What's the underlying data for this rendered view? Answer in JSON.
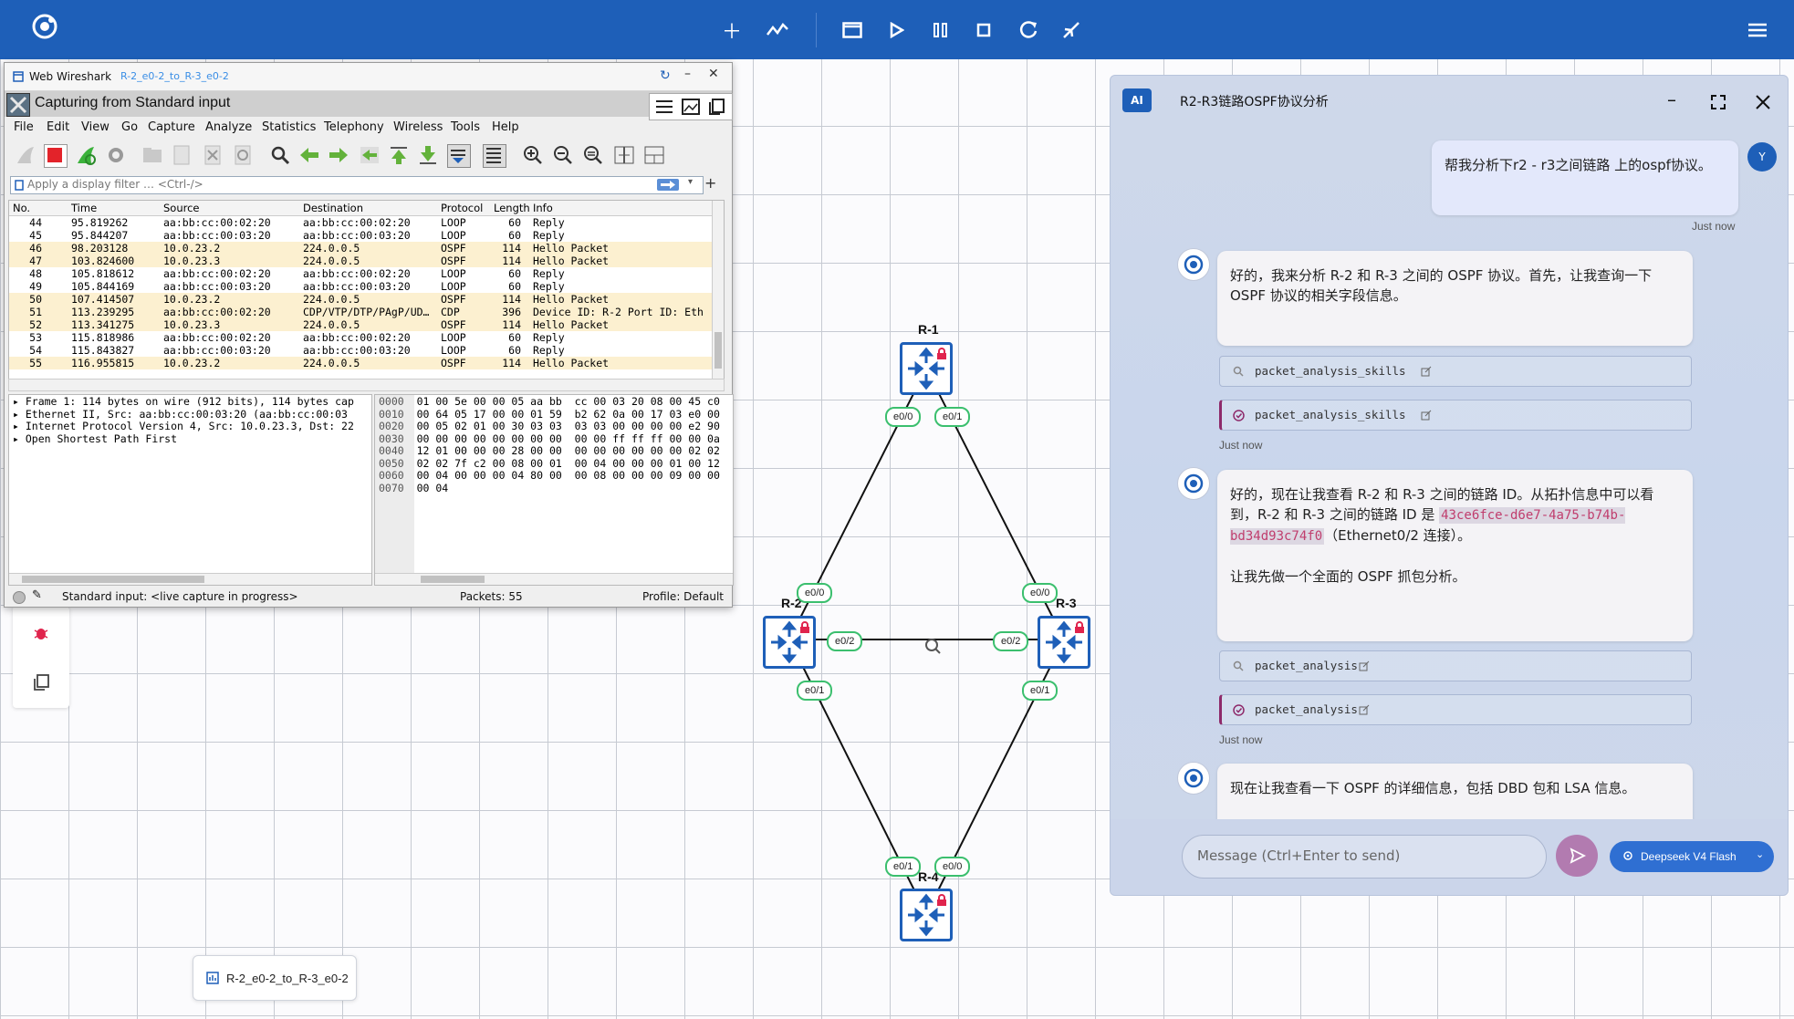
{
  "toolbar": {
    "icons": [
      "plus-icon",
      "chart-line-icon",
      "window-icon",
      "play-icon",
      "pause-icon",
      "stop-icon",
      "reload-icon",
      "collapse-icon",
      "menu-icon"
    ]
  },
  "link_tab": {
    "label": "R-2_e0-2_to_R-3_e0-2"
  },
  "topology": {
    "routers": [
      "R-1",
      "R-2",
      "R-3",
      "R-4"
    ],
    "ports": {
      "r1_e00": "e0/0",
      "r1_e01": "e0/1",
      "r2_e00": "e0/0",
      "r2_e02": "e0/2",
      "r2_e01": "e0/1",
      "r3_e00": "e0/0",
      "r3_e02": "e0/2",
      "r3_e01": "e0/1",
      "r4_e01": "e0/1",
      "r4_e00": "e0/0"
    },
    "colors": {
      "router": "#1e5fb8",
      "port": "#3bbf6e",
      "lock": "#e0244d"
    }
  },
  "wireshark": {
    "app_title": "Web Wireshark",
    "tab_title": "R-2_e0-2_to_R-3_e0-2",
    "capture_title": "Capturing from Standard input",
    "menu": [
      "File",
      "Edit",
      "View",
      "Go",
      "Capture",
      "Analyze",
      "Statistics",
      "Telephony",
      "Wireless",
      "Tools",
      "Help"
    ],
    "filter_placeholder": "Apply a display filter … <Ctrl-/>",
    "columns": [
      "No.",
      "Time",
      "Source",
      "Destination",
      "Protocol",
      "Length",
      "Info"
    ],
    "packets": [
      {
        "no": "44",
        "time": "95.819262",
        "src": "aa:bb:cc:00:02:20",
        "dst": "aa:bb:cc:00:02:20",
        "proto": "LOOP",
        "len": "60",
        "info": "Reply",
        "hl": false
      },
      {
        "no": "45",
        "time": "95.844207",
        "src": "aa:bb:cc:00:03:20",
        "dst": "aa:bb:cc:00:03:20",
        "proto": "LOOP",
        "len": "60",
        "info": "Reply",
        "hl": false
      },
      {
        "no": "46",
        "time": "98.203128",
        "src": "10.0.23.2",
        "dst": "224.0.0.5",
        "proto": "OSPF",
        "len": "114",
        "info": "Hello Packet",
        "hl": true
      },
      {
        "no": "47",
        "time": "103.824600",
        "src": "10.0.23.3",
        "dst": "224.0.0.5",
        "proto": "OSPF",
        "len": "114",
        "info": "Hello Packet",
        "hl": true
      },
      {
        "no": "48",
        "time": "105.818612",
        "src": "aa:bb:cc:00:02:20",
        "dst": "aa:bb:cc:00:02:20",
        "proto": "LOOP",
        "len": "60",
        "info": "Reply",
        "hl": false
      },
      {
        "no": "49",
        "time": "105.844169",
        "src": "aa:bb:cc:00:03:20",
        "dst": "aa:bb:cc:00:03:20",
        "proto": "LOOP",
        "len": "60",
        "info": "Reply",
        "hl": false
      },
      {
        "no": "50",
        "time": "107.414507",
        "src": "10.0.23.2",
        "dst": "224.0.0.5",
        "proto": "OSPF",
        "len": "114",
        "info": "Hello Packet",
        "hl": true
      },
      {
        "no": "51",
        "time": "113.239295",
        "src": "aa:bb:cc:00:02:20",
        "dst": "CDP/VTP/DTP/PAgP/UD…",
        "proto": "CDP",
        "len": "396",
        "info": "Device ID: R-2  Port ID: Eth",
        "hl": true
      },
      {
        "no": "52",
        "time": "113.341275",
        "src": "10.0.23.3",
        "dst": "224.0.0.5",
        "proto": "OSPF",
        "len": "114",
        "info": "Hello Packet",
        "hl": true
      },
      {
        "no": "53",
        "time": "115.818986",
        "src": "aa:bb:cc:00:02:20",
        "dst": "aa:bb:cc:00:02:20",
        "proto": "LOOP",
        "len": "60",
        "info": "Reply",
        "hl": false
      },
      {
        "no": "54",
        "time": "115.843827",
        "src": "aa:bb:cc:00:03:20",
        "dst": "aa:bb:cc:00:03:20",
        "proto": "LOOP",
        "len": "60",
        "info": "Reply",
        "hl": false
      },
      {
        "no": "55",
        "time": "116.955815",
        "src": "10.0.23.2",
        "dst": "224.0.0.5",
        "proto": "OSPF",
        "len": "114",
        "info": "Hello Packet",
        "hl": true
      }
    ],
    "details": [
      "Frame 1: 114 bytes on wire (912 bits), 114 bytes cap",
      "Ethernet II, Src: aa:bb:cc:00:03:20 (aa:bb:cc:00:03",
      "Internet Protocol Version 4, Src: 10.0.23.3, Dst: 22",
      "Open Shortest Path First"
    ],
    "hex": [
      {
        "off": "0000",
        "bytes": "01 00 5e 00 00 05 aa bb  cc 00 03 20 08 00 45 c0"
      },
      {
        "off": "0010",
        "bytes": "00 64 05 17 00 00 01 59  b2 62 0a 00 17 03 e0 00"
      },
      {
        "off": "0020",
        "bytes": "00 05 02 01 00 30 03 03  03 03 00 00 00 00 e2 90"
      },
      {
        "off": "0030",
        "bytes": "00 00 00 00 00 00 00 00  00 00 ff ff ff 00 00 0a"
      },
      {
        "off": "0040",
        "bytes": "12 01 00 00 00 28 00 00  00 00 00 00 00 00 02 02"
      },
      {
        "off": "0050",
        "bytes": "02 02 7f c2 00 08 00 01  00 04 00 00 00 01 00 12"
      },
      {
        "off": "0060",
        "bytes": "00 04 00 00 00 04 80 00  00 08 00 00 00 09 00 00"
      },
      {
        "off": "0070",
        "bytes": "00 04"
      }
    ],
    "status_text": "Standard input: <live capture in progress>",
    "packets_count": "Packets: 55",
    "profile": "Profile: Default"
  },
  "ai": {
    "badge": "AI",
    "title": "R2-R3链路OSPF协议分析",
    "user_avatar": "Y",
    "user_msg": "帮我分析下r2 - r3之间链路 上的ospf协议。",
    "just_now": "Just now",
    "msg1": "好的，我来分析 R-2 和 R-3 之间的 OSPF 协议。首先，让我查询一下 OSPF 协议的相关字段信息。",
    "tool1": "packet_analysis_skills",
    "tool2": "packet_analysis_skills",
    "msg2_a": "好的，现在让我查看 R-2 和 R-3 之间的链路 ID。从拓扑信息中可以看到，R-2 和 R-3 之间的链路 ID 是 ",
    "msg2_code": "43ce6fce-d6e7-4a75-b74b-bd34d93c74f0",
    "msg2_b": "（Ethernet0/2 连接）。",
    "msg2_c": "让我先做一个全面的 OSPF 抓包分析。",
    "tool3": "packet_analysis",
    "tool4": "packet_analysis",
    "msg3": "现在让我查看一下 OSPF 的详细信息，包括 DBD 包和 LSA 信息。",
    "input_placeholder": "Message (Ctrl+Enter to send)",
    "model": "Deepseek V4 Flash",
    "colors": {
      "accent": "#1e5fb8",
      "send": "#b27bb0",
      "code": "#c03d6d"
    }
  }
}
